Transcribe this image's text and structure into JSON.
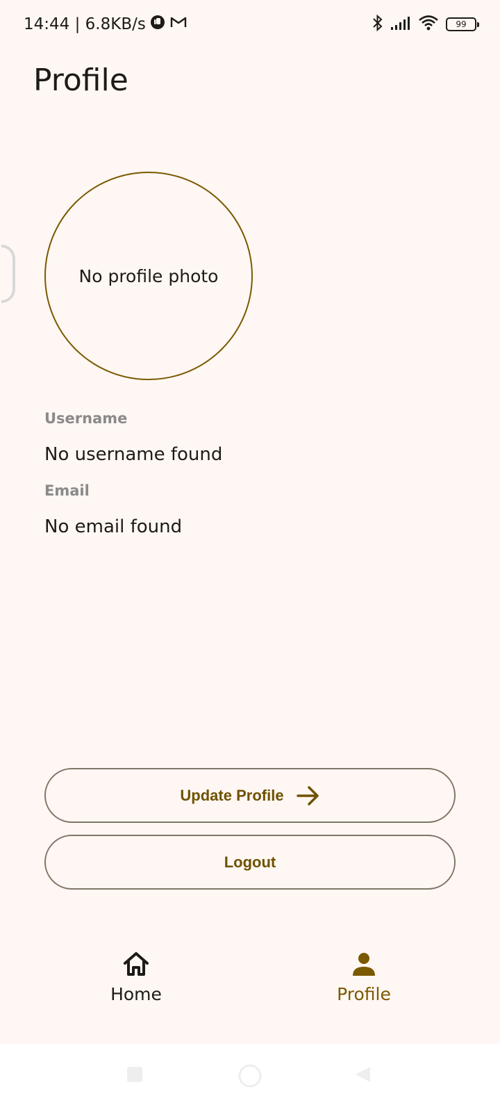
{
  "status_bar": {
    "time_and_speed": "14:44 | 6.8KB/s",
    "battery_level": "99"
  },
  "header": {
    "title": "Profile"
  },
  "avatar": {
    "placeholder": "No profile photo",
    "border_color": "#7a5900"
  },
  "fields": {
    "username_label": "Username",
    "username_value": "No username found",
    "email_label": "Email",
    "email_value": "No email found"
  },
  "actions": {
    "update_label": "Update Profile",
    "logout_label": "Logout",
    "accent": "#6e5200"
  },
  "bottom_nav": {
    "items": [
      {
        "label": "Home",
        "icon": "home-icon",
        "selected": false
      },
      {
        "label": "Profile",
        "icon": "person-icon",
        "selected": true
      }
    ]
  },
  "system_nav": {
    "icons": [
      "square-recents-icon",
      "circle-home-icon",
      "triangle-back-icon"
    ]
  }
}
